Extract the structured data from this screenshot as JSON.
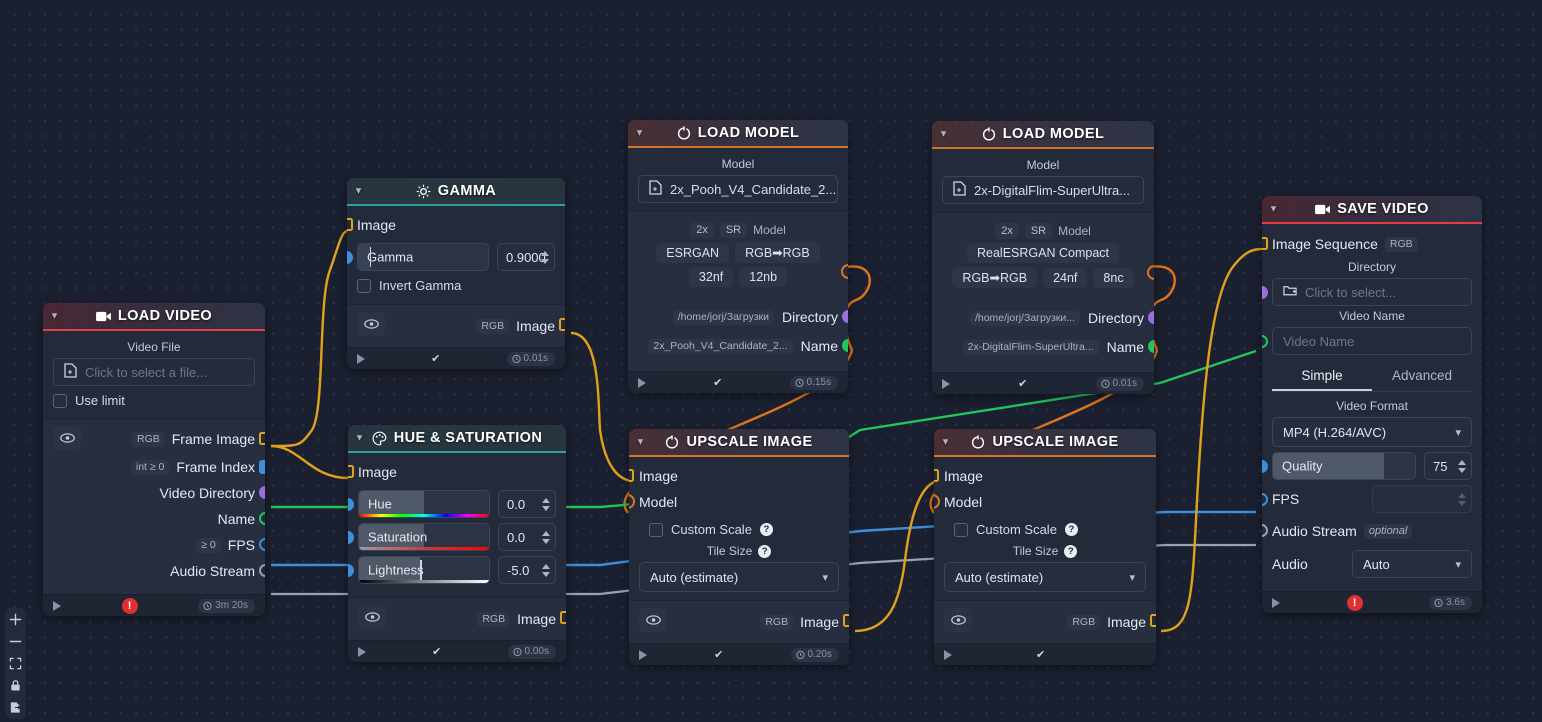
{
  "app": {
    "canvas_name": "node-graph-editor"
  },
  "toolbar": {
    "items": [
      {
        "name": "zoom-in-icon",
        "glyph": "+"
      },
      {
        "name": "zoom-out-icon",
        "glyph": "−"
      },
      {
        "name": "fit-view-icon",
        "glyph": "⛶"
      },
      {
        "name": "lock-icon",
        "glyph": "ὑ2"
      },
      {
        "name": "export-icon",
        "glyph": "⎙"
      }
    ]
  },
  "nodes": {
    "load_video": {
      "title": "LOAD VIDEO",
      "icon": "video-camera-icon",
      "accent": "#e03f4a",
      "field_label": "Video File",
      "file_placeholder": "Click to select a file...",
      "checkbox_label": "Use limit",
      "outputs": [
        {
          "tag": "RGB",
          "label": "Frame Image",
          "socket": "square-yellow"
        },
        {
          "tag": "int ≥ 0",
          "label": "Frame Index",
          "socket": "square-blue"
        },
        {
          "tag": "",
          "label": "Video Directory",
          "socket": "circle-purple"
        },
        {
          "tag": "",
          "label": "Name",
          "socket": "circle-green-outline"
        },
        {
          "tag": "≥ 0",
          "label": "FPS",
          "socket": "circle-blue-outline"
        },
        {
          "tag": "",
          "label": "Audio Stream",
          "socket": "circle-gray-outline"
        }
      ],
      "footer": {
        "status": "error",
        "time": "3m 20s"
      }
    },
    "gamma": {
      "title": "GAMMA",
      "icon": "brightness-icon",
      "accent": "#2e9e9a",
      "input_label": "Image",
      "slider": {
        "label": "Gamma",
        "value": "0.9000",
        "fill_pct": 9
      },
      "checkbox_label": "Invert Gamma",
      "output": {
        "tag": "RGB",
        "label": "Image"
      },
      "footer": {
        "status": "ok",
        "time": "0.01s"
      }
    },
    "hue_saturation": {
      "title": "HUE & SATURATION",
      "icon": "palette-icon",
      "accent": "#2e9e9a",
      "input_label": "Image",
      "sliders": [
        {
          "label": "Hue",
          "value": "0.0",
          "fill_pct": 50,
          "gradient": "hue"
        },
        {
          "label": "Saturation",
          "value": "0.0",
          "fill_pct": 50,
          "gradient": "saturation"
        },
        {
          "label": "Lightness",
          "value": "-5.0",
          "fill_pct": 47,
          "gradient": "lightness"
        }
      ],
      "output": {
        "tag": "RGB",
        "label": "Image"
      },
      "footer": {
        "status": "ok",
        "time": "0.00s"
      }
    },
    "load_model_1": {
      "title": "LOAD MODEL",
      "icon": "loader-icon",
      "accent": "#d2722b",
      "field_label": "Model",
      "file_value": "2x_Pooh_V4_Candidate_2...",
      "meta_tags": [
        "2x",
        "SR",
        "Model"
      ],
      "arch_tags": [
        "ESRGAN",
        "RGB➡RGB"
      ],
      "size_tags": [
        "32nf",
        "12nb"
      ],
      "outputs": [
        {
          "tag": "",
          "label": "Model",
          "socket": "circle-orange-outline"
        },
        {
          "tag": "/home/jorj/Загрузки",
          "label": "Directory",
          "socket": "circle-purple"
        },
        {
          "tag": "2x_Pooh_V4_Candidate_2...",
          "label": "Name",
          "socket": "circle-green"
        }
      ],
      "footer": {
        "status": "ok",
        "time": "0.15s"
      }
    },
    "load_model_2": {
      "title": "LOAD MODEL",
      "icon": "loader-icon",
      "accent": "#d2722b",
      "field_label": "Model",
      "file_value": "2x-DigitalFlim-SuperUltra...",
      "meta_tags": [
        "2x",
        "SR",
        "Model"
      ],
      "arch_tags": [
        "RealESRGAN Compact"
      ],
      "size_tags": [
        "RGB➡RGB",
        "24nf",
        "8nc"
      ],
      "outputs": [
        {
          "tag": "",
          "label": "Model",
          "socket": "circle-orange-outline"
        },
        {
          "tag": "/home/jorj/Загрузки...",
          "label": "Directory",
          "socket": "circle-purple"
        },
        {
          "tag": "2x-DigitalFlim-SuperUltra...",
          "label": "Name",
          "socket": "circle-green"
        }
      ],
      "footer": {
        "status": "ok",
        "time": "0.01s"
      }
    },
    "upscale_1": {
      "title": "UPSCALE IMAGE",
      "icon": "loader-icon",
      "accent": "#d2722b",
      "inputs": [
        {
          "label": "Image",
          "socket": "square-yellow"
        },
        {
          "label": "Model",
          "socket": "circle-orange-outline"
        }
      ],
      "checkbox_label": "Custom Scale",
      "tile_label": "Tile Size",
      "tile_value": "Auto (estimate)",
      "output": {
        "tag": "RGB",
        "label": "Image"
      },
      "footer": {
        "status": "ok",
        "time": "0.20s"
      }
    },
    "upscale_2": {
      "title": "UPSCALE IMAGE",
      "icon": "loader-icon",
      "accent": "#d2722b",
      "inputs": [
        {
          "label": "Image",
          "socket": "square-yellow"
        },
        {
          "label": "Model",
          "socket": "circle-orange-outline"
        }
      ],
      "checkbox_label": "Custom Scale",
      "tile_label": "Tile Size",
      "tile_value": "Auto (estimate)",
      "output": {
        "tag": "RGB",
        "label": "Image"
      },
      "footer": {
        "status": "ok",
        "time": ""
      }
    },
    "save_video": {
      "title": "SAVE VIDEO",
      "icon": "video-camera-icon",
      "accent": "#e03f4a",
      "image_seq_label": "Image Sequence",
      "image_seq_tag": "RGB",
      "directory_label": "Directory",
      "directory_placeholder": "Click to select...",
      "video_name_label": "Video Name",
      "video_name_placeholder": "Video Name",
      "tabs": [
        {
          "label": "Simple",
          "active": true
        },
        {
          "label": "Advanced",
          "active": false
        }
      ],
      "video_format_label": "Video Format",
      "video_format_value": "MP4 (H.264/AVC)",
      "quality": {
        "label": "Quality",
        "value": "75",
        "fill_pct": 78
      },
      "fps_label": "FPS",
      "fps_value": "",
      "audio_stream_label": "Audio Stream",
      "audio_stream_note": "optional",
      "audio_label": "Audio",
      "audio_value": "Auto",
      "footer": {
        "status": "error",
        "time": "3.6s"
      }
    }
  },
  "colors": {
    "edge_yellow": "#e0a21c",
    "edge_orange": "#e0751c",
    "edge_green": "#22c55e",
    "edge_blue": "#3d8fdb",
    "edge_gray": "#98a2b3",
    "accent_red": "#e03f4a",
    "accent_teal": "#2e9e9a",
    "background": "#1b2030"
  }
}
